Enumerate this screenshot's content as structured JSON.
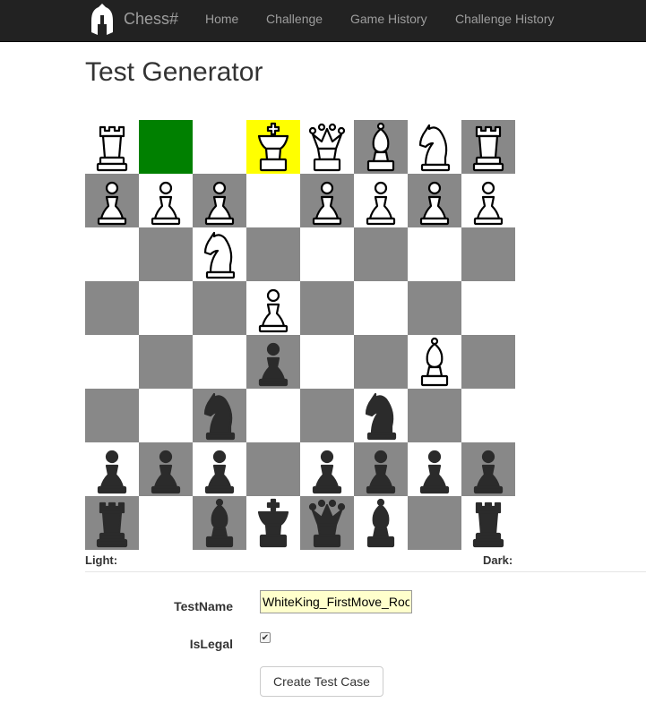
{
  "navbar": {
    "brand": "Chess#",
    "links": [
      "Home",
      "Challenge",
      "Game History",
      "Challenge History"
    ]
  },
  "page": {
    "title": "Test Generator"
  },
  "board": {
    "rows": [
      [
        {
          "p": "rook",
          "c": "white"
        },
        {
          "p": "",
          "c": "",
          "state": "selected"
        },
        {
          "p": "",
          "c": ""
        },
        {
          "p": "king",
          "c": "white",
          "state": "highlight"
        },
        {
          "p": "queen",
          "c": "white"
        },
        {
          "p": "bishop",
          "c": "white"
        },
        {
          "p": "knight",
          "c": "white"
        },
        {
          "p": "rook",
          "c": "white"
        }
      ],
      [
        {
          "p": "pawn",
          "c": "white"
        },
        {
          "p": "pawn",
          "c": "white"
        },
        {
          "p": "pawn",
          "c": "white"
        },
        {
          "p": "",
          "c": ""
        },
        {
          "p": "pawn",
          "c": "white"
        },
        {
          "p": "pawn",
          "c": "white"
        },
        {
          "p": "pawn",
          "c": "white"
        },
        {
          "p": "pawn",
          "c": "white"
        }
      ],
      [
        {
          "p": "",
          "c": ""
        },
        {
          "p": "",
          "c": ""
        },
        {
          "p": "knight",
          "c": "white"
        },
        {
          "p": "",
          "c": ""
        },
        {
          "p": "",
          "c": ""
        },
        {
          "p": "",
          "c": ""
        },
        {
          "p": "",
          "c": ""
        },
        {
          "p": "",
          "c": ""
        }
      ],
      [
        {
          "p": "",
          "c": ""
        },
        {
          "p": "",
          "c": ""
        },
        {
          "p": "",
          "c": ""
        },
        {
          "p": "pawn",
          "c": "white"
        },
        {
          "p": "",
          "c": ""
        },
        {
          "p": "",
          "c": ""
        },
        {
          "p": "",
          "c": ""
        },
        {
          "p": "",
          "c": ""
        }
      ],
      [
        {
          "p": "",
          "c": ""
        },
        {
          "p": "",
          "c": ""
        },
        {
          "p": "",
          "c": ""
        },
        {
          "p": "pawn",
          "c": "black"
        },
        {
          "p": "",
          "c": ""
        },
        {
          "p": "",
          "c": ""
        },
        {
          "p": "bishop",
          "c": "white"
        },
        {
          "p": "",
          "c": ""
        }
      ],
      [
        {
          "p": "",
          "c": ""
        },
        {
          "p": "",
          "c": ""
        },
        {
          "p": "knight",
          "c": "black"
        },
        {
          "p": "",
          "c": ""
        },
        {
          "p": "",
          "c": ""
        },
        {
          "p": "knight",
          "c": "black"
        },
        {
          "p": "",
          "c": ""
        },
        {
          "p": "",
          "c": ""
        }
      ],
      [
        {
          "p": "pawn",
          "c": "black"
        },
        {
          "p": "pawn",
          "c": "black"
        },
        {
          "p": "pawn",
          "c": "black"
        },
        {
          "p": "",
          "c": ""
        },
        {
          "p": "pawn",
          "c": "black"
        },
        {
          "p": "pawn",
          "c": "black"
        },
        {
          "p": "pawn",
          "c": "black"
        },
        {
          "p": "pawn",
          "c": "black"
        }
      ],
      [
        {
          "p": "rook",
          "c": "black"
        },
        {
          "p": "",
          "c": ""
        },
        {
          "p": "bishop",
          "c": "black"
        },
        {
          "p": "king",
          "c": "black"
        },
        {
          "p": "queen",
          "c": "black"
        },
        {
          "p": "bishop",
          "c": "black"
        },
        {
          "p": "",
          "c": ""
        },
        {
          "p": "rook",
          "c": "black"
        }
      ]
    ],
    "colors": {
      "light": "#ffffff",
      "dark": "#888888",
      "selected": "#008000",
      "highlight": "#ffff00"
    }
  },
  "labels": {
    "light": "Light:",
    "dark": "Dark:"
  },
  "form": {
    "test_name_label": "TestName",
    "test_name_value": "WhiteKing_FirstMove_Roo",
    "is_legal_label": "IsLegal",
    "is_legal_checked": true,
    "submit_label": "Create Test Case"
  }
}
